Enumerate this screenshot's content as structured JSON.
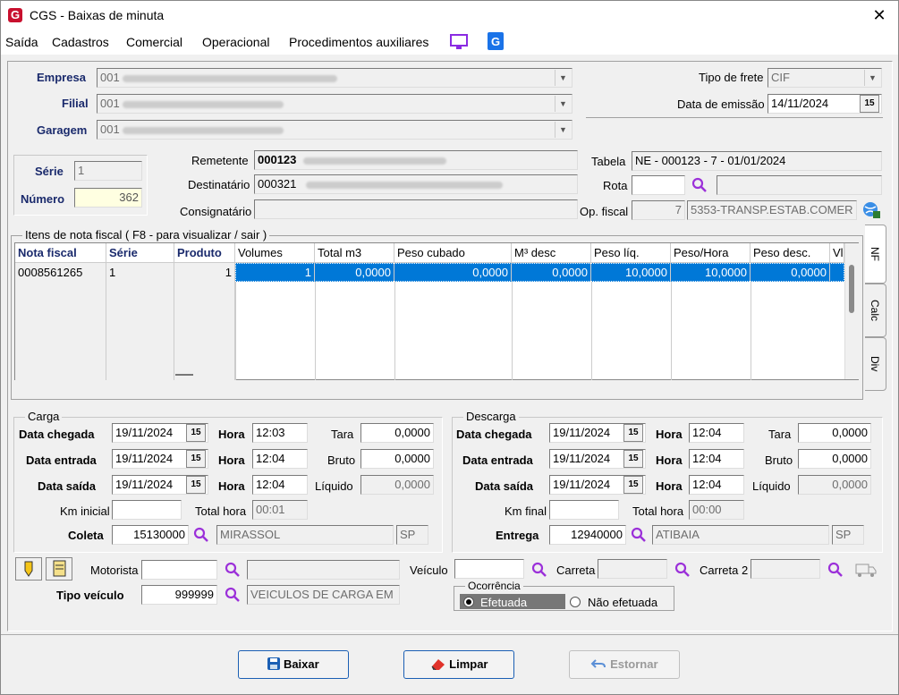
{
  "window": {
    "title": "CGS - Baixas de minuta",
    "close": "✕",
    "logo": "G"
  },
  "menu": [
    "Saída",
    "Cadastros",
    "Comercial",
    "Operacional",
    "Procedimentos auxiliares"
  ],
  "header": {
    "empresa_label": "Empresa",
    "empresa_value": "001",
    "filial_label": "Filial",
    "filial_value": "001",
    "garagem_label": "Garagem",
    "garagem_value": "001",
    "tipo_frete_label": "Tipo de frete",
    "tipo_frete_value": "CIF",
    "data_emissao_label": "Data de emissão",
    "data_emissao_value": "14/11/2024"
  },
  "doc": {
    "serie_label": "Série",
    "serie_value": "1",
    "numero_label": "Número",
    "numero_value": "362",
    "remetente_label": "Remetente",
    "remetente_code": "000123",
    "destinatario_label": "Destinatário",
    "destinatario_code": "000321",
    "consignatario_label": "Consignatário",
    "tabela_label": "Tabela",
    "tabela_value": "NE - 000123 - 7 - 01/01/2024",
    "rota_label": "Rota",
    "opfiscal_label": "Op. fiscal",
    "opfiscal_code": "7",
    "opfiscal_desc": "5353-TRANSP.ESTAB.COMER"
  },
  "items": {
    "title": "Itens de nota fiscal ( F8 - para visualizar / sair )",
    "columns": [
      "Nota fiscal",
      "Série",
      "Produto",
      "Volumes",
      "Total m3",
      "Peso cubado",
      "M³ desc",
      "Peso líq.",
      "Peso/Hora",
      "Peso desc.",
      "Vl"
    ],
    "rows": [
      [
        "0008561265",
        "1",
        "1",
        "1",
        "0,0000",
        "0,0000",
        "0,0000",
        "10,0000",
        "10,0000",
        "0,0000",
        ""
      ]
    ],
    "tabs": [
      "NF",
      "Calc",
      "Div"
    ]
  },
  "carga": {
    "title": "Carga",
    "data_chegada_label": "Data chegada",
    "data_chegada": "19/11/2024",
    "hora1": "12:03",
    "data_entrada_label": "Data entrada",
    "data_entrada": "19/11/2024",
    "hora2": "12:04",
    "data_saida_label": "Data saída",
    "data_saida": "19/11/2024",
    "hora3": "12:04",
    "hora_label": "Hora",
    "tara_label": "Tara",
    "tara": "0,0000",
    "bruto_label": "Bruto",
    "bruto": "0,0000",
    "liquido_label": "Líquido",
    "liquido": "0,0000",
    "km_label": "Km inicial",
    "total_hora_label": "Total hora",
    "total_hora": "00:01",
    "coleta_label": "Coleta",
    "coleta_code": "15130000",
    "coleta_city": "MIRASSOL",
    "coleta_uf": "SP"
  },
  "descarga": {
    "title": "Descarga",
    "data_chegada_label": "Data chegada",
    "data_chegada": "19/11/2024",
    "hora1": "12:04",
    "data_entrada_label": "Data entrada",
    "data_entrada": "19/11/2024",
    "hora2": "12:04",
    "data_saida_label": "Data saída",
    "data_saida": "19/11/2024",
    "hora3": "12:04",
    "hora_label": "Hora",
    "tara_label": "Tara",
    "tara": "0,0000",
    "bruto_label": "Bruto",
    "bruto": "0,0000",
    "liquido_label": "Líquido",
    "liquido": "0,0000",
    "km_label": "Km final",
    "total_hora_label": "Total hora",
    "total_hora": "00:00",
    "entrega_label": "Entrega",
    "entrega_code": "12940000",
    "entrega_city": "ATIBAIA",
    "entrega_uf": "SP"
  },
  "transport": {
    "motorista_label": "Motorista",
    "veiculo_label": "Veículo",
    "carreta_label": "Carreta",
    "carreta2_label": "Carreta 2",
    "tipo_veiculo_label": "Tipo veículo",
    "tipo_veiculo_code": "999999",
    "tipo_veiculo_desc": "VEICULOS DE CARGA EM",
    "ocorrencia_title": "Ocorrência",
    "efetuada": "Efetuada",
    "nao_efetuada": "Não efetuada"
  },
  "buttons": {
    "baixar": "Baixar",
    "limpar": "Limpar",
    "estornar": "Estornar"
  },
  "colors": {
    "selection": "#0078d7",
    "accent": "#1a2a6c",
    "button_border": "#1a5fb4"
  }
}
